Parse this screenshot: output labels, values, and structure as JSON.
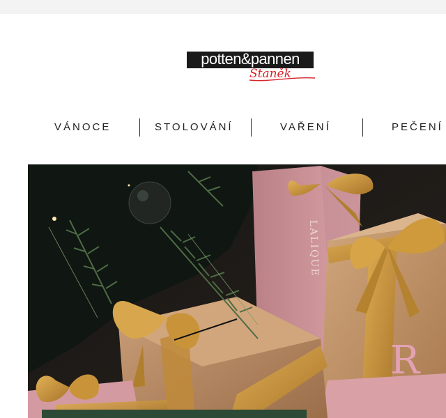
{
  "logo": {
    "brand": "potten&pannen",
    "sub": "Staněk"
  },
  "nav": {
    "items": [
      {
        "label": "VÁNOCE"
      },
      {
        "label": "STOLOVÁNÍ"
      },
      {
        "label": "VAŘENÍ"
      },
      {
        "label": "PEČENÍ"
      }
    ]
  },
  "hero": {
    "box_letter": "R",
    "bag_text": "LALIQUE",
    "colors": {
      "kraft": "#c89a70",
      "ribbon": "#c79035",
      "pink": "#d69aa0",
      "fir": "#3f5a3a"
    }
  }
}
